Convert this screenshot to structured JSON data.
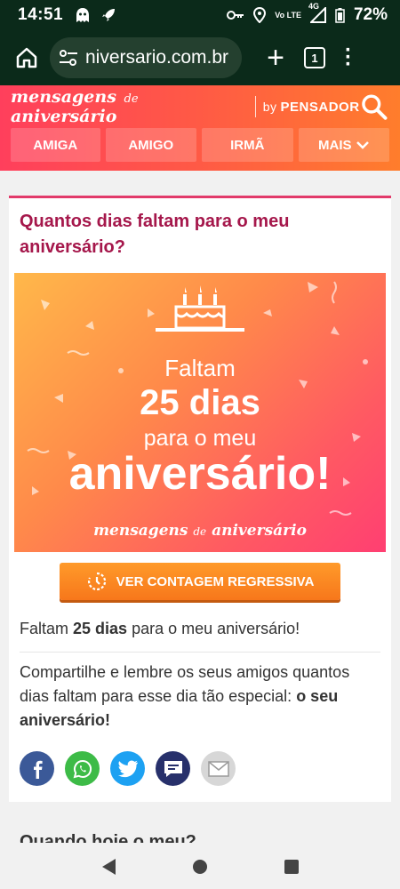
{
  "status": {
    "time": "14:51",
    "network": "Vo LTE",
    "signal_label": "4G",
    "battery": "72%"
  },
  "browser": {
    "url": "niversario.com.br",
    "tab_count": "1"
  },
  "site": {
    "brand_part1": "mensagens",
    "brand_de": "de",
    "brand_part2": "aniversário",
    "by": "by",
    "publisher": "PENSADOR",
    "nav": [
      {
        "label": "AMIGA"
      },
      {
        "label": "AMIGO"
      },
      {
        "label": "IRMÃ"
      },
      {
        "label": "MAIS"
      }
    ]
  },
  "card": {
    "title": "Quantos dias faltam para o meu aniversário?",
    "banner": {
      "line1": "Faltam",
      "line2": "25 dias",
      "line3": "para o meu",
      "line4": "aniversário!",
      "brand_part1": "mensagens",
      "brand_de": "de",
      "brand_part2": "aniversário"
    },
    "countdown_button": "VER CONTAGEM REGRESSIVA",
    "p1_pre": "Faltam ",
    "p1_bold": "25 dias",
    "p1_post": " para o meu aniversário!",
    "p2_pre": "Compartilhe e lembre os seus amigos quantos dias faltam para esse dia tão especial: ",
    "p2_bold": "o seu aniversário!"
  },
  "share_icons": [
    "facebook-icon",
    "whatsapp-icon",
    "twitter-icon",
    "sms-icon",
    "email-icon"
  ],
  "next_heading": "Quando hoje o meu?",
  "colors": {
    "accent": "#a5174b",
    "header_start": "#ff3f5c",
    "header_end": "#ff7d2c",
    "button": "#f7771b"
  }
}
